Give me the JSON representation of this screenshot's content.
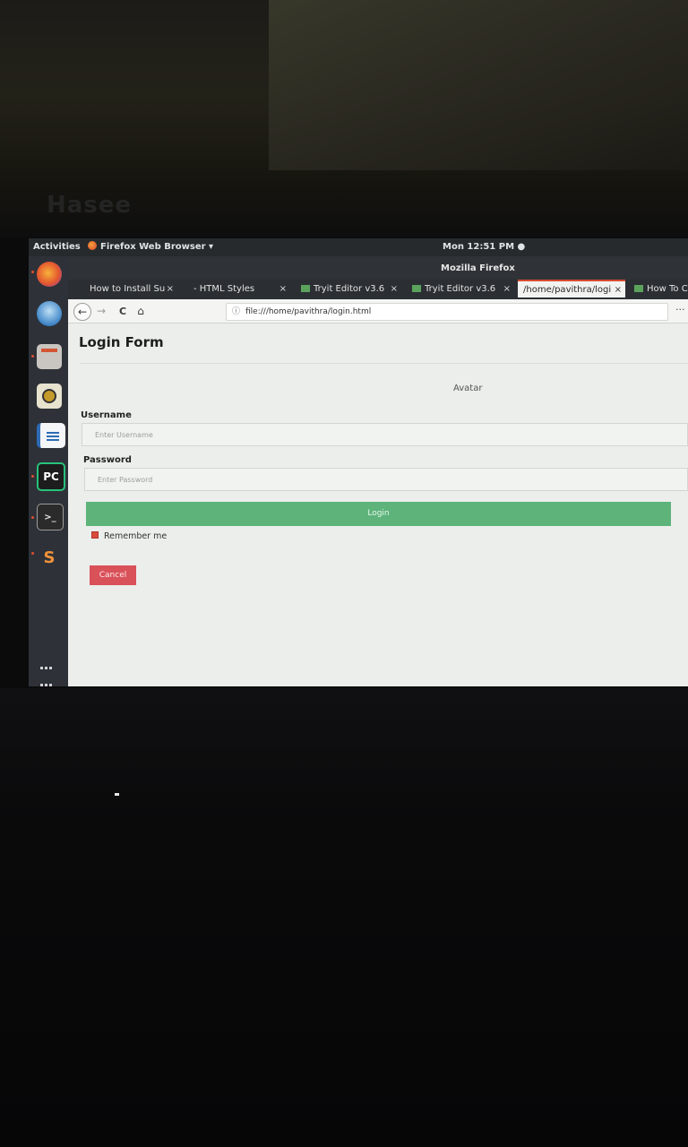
{
  "topbar": {
    "activities": "Activities",
    "app_menu": "Firefox Web Browser ▾",
    "clock": "Mon 12:51 PM ●"
  },
  "window": {
    "title": "Mozilla Firefox"
  },
  "tabs": [
    {
      "label": "How to Install Su",
      "close": "×"
    },
    {
      "label": "- HTML Styles",
      "close": "×"
    },
    {
      "label": "Tryit Editor v3.6",
      "close": "×"
    },
    {
      "label": "Tryit Editor v3.6",
      "close": "×"
    },
    {
      "label": "/home/pavithra/logi",
      "close": "×",
      "active": true
    },
    {
      "label": "How To Cr",
      "close": ""
    }
  ],
  "nav": {
    "url": "file:///home/pavithra/login.html",
    "back_glyph": "←",
    "forward_glyph": "→",
    "reload_glyph": "C",
    "home_glyph": "⌂",
    "more_glyph": "···",
    "info_glyph": "ⓘ"
  },
  "page": {
    "title": "Login Form",
    "avatar_alt": "Avatar",
    "username_label": "Username",
    "username_placeholder": "Enter Username",
    "password_label": "Password",
    "password_placeholder": "Enter Password",
    "login_button": "Login",
    "remember_label": "Remember me",
    "cancel_button": "Cancel"
  },
  "dock": {
    "items": [
      "firefox-icon",
      "thunderbird-icon",
      "files-icon",
      "rhythmbox-icon",
      "writer-icon",
      "pycharm-icon",
      "terminal-icon",
      "sublime-icon"
    ],
    "pycharm_text": "PC",
    "terminal_text": ">_",
    "sublime_text": "S"
  },
  "colors": {
    "login_green": "#5db37a",
    "cancel_red": "#d95159",
    "active_tab_accent": "#d94b32"
  }
}
